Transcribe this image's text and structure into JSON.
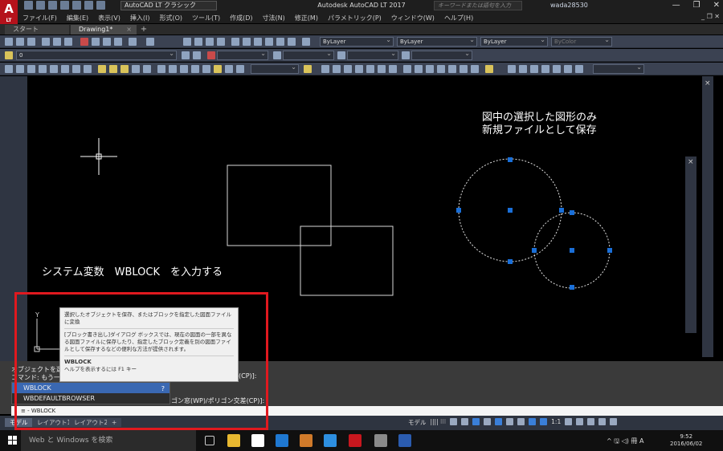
{
  "window": {
    "app_logo": "A",
    "app_logo_sub": "LT",
    "workspace": "AutoCAD LT クラシック",
    "title": "Autodesk AutoCAD LT 2017",
    "search_placeholder": "キーワードまたは語句を入力",
    "user": "wada28530",
    "minimize": "—",
    "maximize": "❐",
    "close": "✕"
  },
  "menu": {
    "items": [
      "ファイル(F)",
      "編集(E)",
      "表示(V)",
      "挿入(I)",
      "形式(O)",
      "ツール(T)",
      "作成(D)",
      "寸法(N)",
      "修正(M)",
      "パラメトリック(P)",
      "ウィンドウ(W)",
      "ヘルプ(H)"
    ],
    "right_controls": "_ ❐ ✕"
  },
  "tabs": {
    "start": "スタート",
    "drawing": "Drawing1*",
    "close": "×",
    "add": "+"
  },
  "toolbar": {
    "layer": "0",
    "color": "ByLayer",
    "linetype": "ByLayer",
    "lineweight": "ByLayer",
    "plotstyle": "ByColor"
  },
  "annotations": {
    "top_right_line1": "図中の選択した図形のみ",
    "top_right_line2": "新規ファイルとして保存",
    "left": "システム変数　WBLOCK　を入力する"
  },
  "tooltip": {
    "description": "選択したオブジェクトを保存、またはブロックを指定した図面ファイルに変換",
    "detail": "[ブロック書き出し]ダイアログ ボックスでは、現在の図面の一部を異なる図面ファイルに保存したり、指定したブロック定義を別の図面ファイルとして保存するなどの便利な方法が提供されます。",
    "command": "WBLOCK",
    "help": "ヘルプを表示するには F1 キー"
  },
  "command": {
    "history1": "オブジェクトを選択",
    "history2": "コマンド: もう一方",
    "right_text1": "(CP)]:",
    "right_text2": "ゴン窓(WP)/ポリゴン交差(CP)]:",
    "autocomplete": [
      "WBLOCK",
      "WBDEFAULTBROWSER"
    ],
    "input": "WBLOCK",
    "prompt": "≡ -"
  },
  "layout_tabs": [
    "モデル",
    "レイアウト1",
    "レイアウト2"
  ],
  "layout_add": "+",
  "status": {
    "model": "モデル",
    "grid": "|||| ⁝⁝⁝",
    "scale": "1:1"
  },
  "taskbar": {
    "search": "Web と Windows を検索",
    "time": "9:52",
    "date": "2016/06/02",
    "tray_text": "^ 🖫 ◁) 冊 A"
  },
  "colors": {
    "highlight": "#e0191f",
    "grip": "#1a6fd8",
    "accent": "#b5121b"
  }
}
